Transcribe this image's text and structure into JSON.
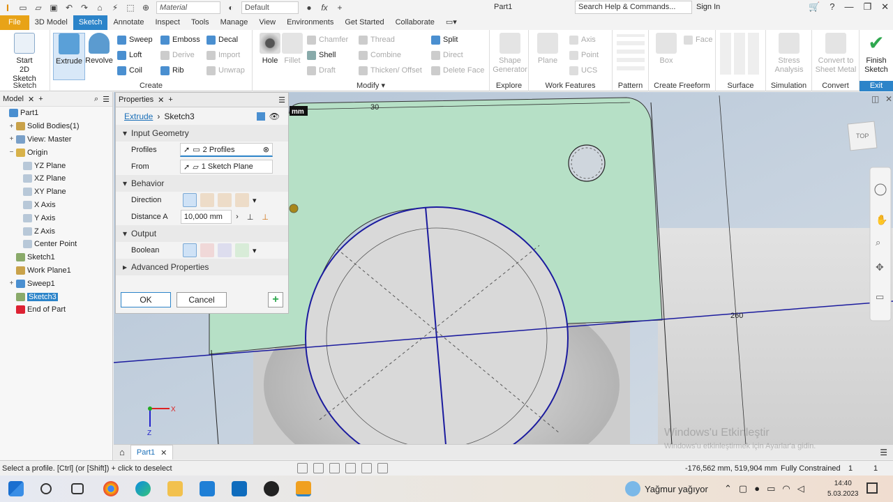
{
  "app": {
    "document_title": "Part1",
    "material_placeholder": "Material",
    "appearance": "Default",
    "search_placeholder": "Search Help & Commands...",
    "sign_in": "Sign In"
  },
  "tabs": [
    "File",
    "3D Model",
    "Sketch",
    "Annotate",
    "Inspect",
    "Tools",
    "Manage",
    "View",
    "Environments",
    "Get Started",
    "Collaborate"
  ],
  "ribbon": {
    "sketch_panel": {
      "label": "Sketch",
      "start_sketch": "Start\n2D Sketch"
    },
    "create_panel": {
      "label": "Create",
      "extrude": "Extrude",
      "revolve": "Revolve",
      "sweep": "Sweep",
      "emboss": "Emboss",
      "decal": "Decal",
      "loft": "Loft",
      "derive": "Derive",
      "import": "Import",
      "coil": "Coil",
      "rib": "Rib",
      "unwrap": "Unwrap"
    },
    "modify_panel": {
      "label": "Modify",
      "hole": "Hole",
      "fillet": "Fillet",
      "chamfer": "Chamfer",
      "shell": "Shell",
      "draft": "Draft",
      "thread": "Thread",
      "combine": "Combine",
      "thicken": "Thicken/ Offset",
      "split": "Split",
      "direct": "Direct",
      "delete_face": "Delete Face"
    },
    "explore_panel": {
      "label": "Explore",
      "shape_generator": "Shape Generator"
    },
    "work_features_panel": {
      "label": "Work Features",
      "plane": "Plane",
      "axis": "Axis",
      "point": "Point",
      "ucs": "UCS"
    },
    "pattern_panel": {
      "label": "Pattern"
    },
    "freeform_panel": {
      "label": "Create Freeform",
      "box": "Box",
      "face": "Face"
    },
    "surface_panel": {
      "label": "Surface"
    },
    "simulation_panel": {
      "label": "Simulation",
      "stress": "Stress Analysis"
    },
    "convert_panel": {
      "label": "Convert",
      "convert_sheet": "Convert to Sheet Metal"
    },
    "exit_panel": {
      "label": "Exit",
      "finish": "Finish Sketch"
    }
  },
  "browser": {
    "tab": "Model",
    "items": [
      {
        "label": "Part1",
        "indent": 0,
        "exp": ""
      },
      {
        "label": "Solid Bodies(1)",
        "indent": 1,
        "exp": "+"
      },
      {
        "label": "View: Master",
        "indent": 1,
        "exp": "+"
      },
      {
        "label": "Origin",
        "indent": 1,
        "exp": "−"
      },
      {
        "label": "YZ Plane",
        "indent": 2,
        "exp": ""
      },
      {
        "label": "XZ Plane",
        "indent": 2,
        "exp": ""
      },
      {
        "label": "XY Plane",
        "indent": 2,
        "exp": ""
      },
      {
        "label": "X Axis",
        "indent": 2,
        "exp": ""
      },
      {
        "label": "Y Axis",
        "indent": 2,
        "exp": ""
      },
      {
        "label": "Z Axis",
        "indent": 2,
        "exp": ""
      },
      {
        "label": "Center Point",
        "indent": 2,
        "exp": ""
      },
      {
        "label": "Sketch1",
        "indent": 1,
        "exp": ""
      },
      {
        "label": "Work Plane1",
        "indent": 1,
        "exp": ""
      },
      {
        "label": "Sweep1",
        "indent": 1,
        "exp": "+"
      },
      {
        "label": "Sketch3",
        "indent": 1,
        "exp": ""
      },
      {
        "label": "End of Part",
        "indent": 1,
        "exp": ""
      }
    ]
  },
  "properties": {
    "tab": "Properties",
    "breadcrumb_link": "Extrude",
    "breadcrumb_current": "Sketch3",
    "input_geometry": "Input Geometry",
    "profiles_label": "Profiles",
    "profiles_value": "2 Profiles",
    "from_label": "From",
    "from_value": "1 Sketch Plane",
    "behavior": "Behavior",
    "direction_label": "Direction",
    "distance_label": "Distance A",
    "distance_value": "10,000 mm",
    "output": "Output",
    "boolean_label": "Boolean",
    "advanced": "Advanced Properties",
    "ok": "OK",
    "cancel": "Cancel"
  },
  "viewport": {
    "dim_30": "30",
    "dim_260": "260",
    "units_badge": "mm",
    "viewcube": "TOP",
    "axis_x": "X",
    "axis_z": "Z"
  },
  "doc_tab": "Part1",
  "status": {
    "message": "Select a profile. [Ctrl] (or [Shift]) + click to deselect",
    "coords": "-176,562 mm, 519,904 mm",
    "constraint": "Fully Constrained",
    "n1": "1",
    "n2": "1"
  },
  "watermark": {
    "title": "Windows'u Etkinleştir",
    "subtitle": "Windows'u etkinleştirmek için Ayarlar'a gidin."
  },
  "taskbar": {
    "weather": "Yağmur yağıyor",
    "time": "14:40",
    "date": "5.03.2023"
  },
  "colors": {
    "accent": "#2c84c9",
    "file_tab": "#e8a317",
    "sketch_face": "#b6e0c6",
    "sketch_line": "#1b1b9e"
  }
}
